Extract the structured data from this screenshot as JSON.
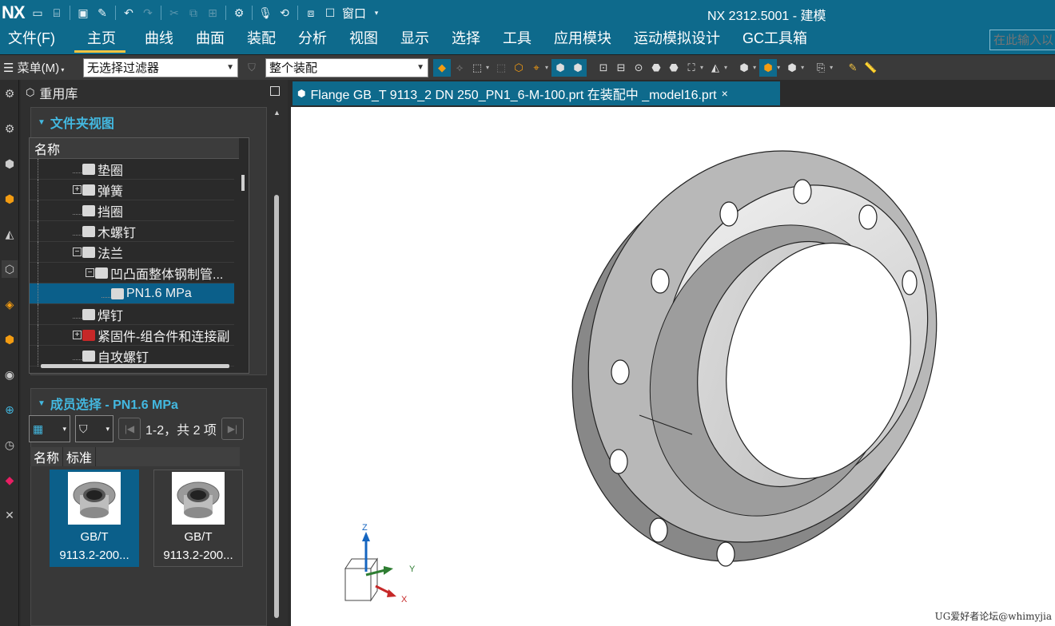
{
  "app": {
    "logo": "NX",
    "title": "NX 2312.5001 - 建模",
    "window_menu": "窗口"
  },
  "menu_tabs": [
    "文件(F)",
    "主页",
    "曲线",
    "曲面",
    "装配",
    "分析",
    "视图",
    "显示",
    "选择",
    "工具",
    "应用模块",
    "运动模拟设计",
    "GC工具箱"
  ],
  "active_tab": "主页",
  "command_search": {
    "placeholder": "在此输入以"
  },
  "toolbar": {
    "menu_label": "菜单(M)",
    "filter_combo": "无选择过滤器",
    "scope_combo": "整个装配"
  },
  "panel": {
    "title": "重用库",
    "folder_view": {
      "title": "文件夹视图",
      "column": "名称",
      "items": [
        {
          "label": "垫圈",
          "expander": "",
          "indent": 1
        },
        {
          "label": "弹簧",
          "expander": "+",
          "indent": 1
        },
        {
          "label": "挡圈",
          "expander": "",
          "indent": 1
        },
        {
          "label": "木螺钉",
          "expander": "",
          "indent": 1
        },
        {
          "label": "法兰",
          "expander": "-",
          "indent": 1
        },
        {
          "label": "凹凸面整体钢制管...",
          "expander": "-",
          "indent": 2
        },
        {
          "label": "PN1.6 MPa",
          "expander": "",
          "indent": 3,
          "selected": true
        },
        {
          "label": "焊钉",
          "expander": "",
          "indent": 1
        },
        {
          "label": "紧固件-组合件和连接副",
          "expander": "+",
          "indent": 1
        },
        {
          "label": "自攻螺钉",
          "expander": "",
          "indent": 1
        }
      ]
    },
    "member_select": {
      "title": "成员选择 - PN1.6 MPa",
      "count": "1-2，共 2 项",
      "columns": [
        "名称",
        "标准"
      ],
      "cards": [
        {
          "line1": "GB/T",
          "line2": "9113.2-200...",
          "selected": true
        },
        {
          "line1": "GB/T",
          "line2": "9113.2-200...",
          "selected": false
        }
      ]
    }
  },
  "document_tab": {
    "label": "Flange GB_T 9113_2 DN 250_PN1_6-M-100.prt 在装配中 _model16.prt",
    "close": "×"
  },
  "triad": {
    "z": "Z",
    "y": "Y",
    "x": "X"
  },
  "watermark": "UG爱好者论坛@whimyjia",
  "colors": {
    "ribbon": "#0e6a8c",
    "accent": "#43b8e0",
    "selection": "#0b5f8a",
    "tab_underline": "#f4c542"
  }
}
